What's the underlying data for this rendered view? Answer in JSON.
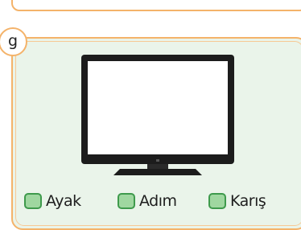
{
  "question": {
    "number": "g",
    "image": "television",
    "options": [
      "Ayak",
      "Adım",
      "Karış"
    ]
  },
  "colors": {
    "frame_border": "#f4b36a",
    "panel_background": "#eaf4ea",
    "checkbox_fill": "#9fd7a0",
    "checkbox_border": "#3e9a4c"
  }
}
